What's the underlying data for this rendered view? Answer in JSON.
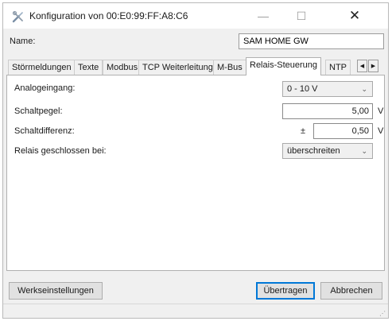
{
  "window": {
    "title": "Konfiguration von 00:E0:99:FF:A8:C6",
    "minimize_glyph": "—",
    "maximize_glyph": "☐",
    "close_glyph": "✕",
    "icon": "tools-icon"
  },
  "name": {
    "label": "Name:",
    "value": "SAM HOME GW"
  },
  "tabs": [
    {
      "label": "Störmeldungen"
    },
    {
      "label": "Texte"
    },
    {
      "label": "Modbus"
    },
    {
      "label": "TCP Weiterleitung"
    },
    {
      "label": "M-Bus"
    },
    {
      "label": "Relais-Steuerung",
      "active": true
    },
    {
      "label": "NTP"
    }
  ],
  "tab_scroll": {
    "left": "◀",
    "right": "▶"
  },
  "fields": {
    "analog": {
      "label": "Analogeingang:",
      "value": "0 - 10 V"
    },
    "schaltpegel": {
      "label": "Schaltpegel:",
      "value": "5,00",
      "unit": "V"
    },
    "schaltdifferenz": {
      "label": "Schaltdifferenz:",
      "prefix": "±",
      "value": "0,50",
      "unit": "V"
    },
    "relais": {
      "label": "Relais geschlossen bei:",
      "value": "überschreiten"
    }
  },
  "chevron": "⌄",
  "buttons": {
    "factory": "Werkseinstellungen",
    "apply": "Übertragen",
    "cancel": "Abbrechen"
  },
  "grip": "⋰"
}
